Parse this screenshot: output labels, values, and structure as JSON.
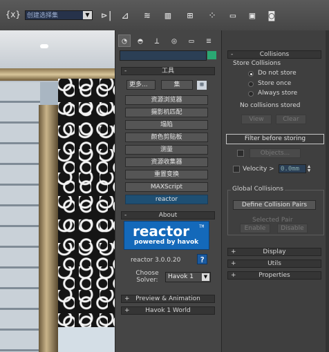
{
  "toolbar": {
    "selection_set_brace": "{x}",
    "selection_set": "创建选择集",
    "icons": [
      "mirror-icon",
      "align-icon",
      "layer-manager-icon",
      "schematic-view-icon",
      "material-editor-icon",
      "render-setup-icon",
      "render-frame-icon",
      "quick-render-icon"
    ]
  },
  "command_panel": {
    "tabs": [
      "create-tab",
      "modify-tab",
      "hierarchy-tab",
      "motion-tab",
      "display-tab",
      "utilities-tab"
    ],
    "tools_rollout": {
      "sign": "-",
      "title": "工具"
    },
    "more_label": "更多...",
    "sets_label": "集",
    "utilities": [
      "资源浏览器",
      "摄影机匹配",
      "塌陷",
      "颜色剪贴板",
      "测量",
      "资源收集器",
      "重置变换",
      "MAXScript",
      "reactor"
    ],
    "about_rollout": {
      "sign": "-",
      "title": "About"
    },
    "logo": {
      "main": "reactor",
      "tm": "TM",
      "sub": "powered by havok"
    },
    "version_label": "reactor 3.0.0.20",
    "help_label": "?",
    "choose_solver_label": "Choose Solver:",
    "solver_value": "Havok 1",
    "preview_rollout": {
      "sign": "+",
      "title": "Preview & Animation"
    },
    "havok_rollout": {
      "sign": "+",
      "title": "Havok 1 World"
    }
  },
  "collisions_panel": {
    "rollout": {
      "sign": "-",
      "title": "Collisions"
    },
    "store_group": "Store Collisions",
    "radios": [
      {
        "label": "Do not store",
        "selected": true
      },
      {
        "label": "Store once",
        "selected": false
      },
      {
        "label": "Always store",
        "selected": false
      }
    ],
    "status": "No collisions stored",
    "view_label": "View",
    "clear_label": "Clear",
    "filter_label": "Filter before storing",
    "objects_label": "Objects...",
    "velocity_label": "Velocity >",
    "velocity_value": "0.0mm",
    "global_group": "Global Collisions",
    "define_label": "Define Collision Pairs",
    "selected_pair_label": "Selected Pair",
    "enable_label": "Enable",
    "disable_label": "Disable",
    "display_rollout": {
      "sign": "+",
      "title": "Display"
    },
    "utils_rollout": {
      "sign": "+",
      "title": "Utils"
    },
    "properties_rollout": {
      "sign": "+",
      "title": "Properties"
    }
  },
  "colors": {
    "accent_selected": "#1e4f73",
    "swatch": "#2aa873",
    "logo_blue": "#1469ba"
  }
}
